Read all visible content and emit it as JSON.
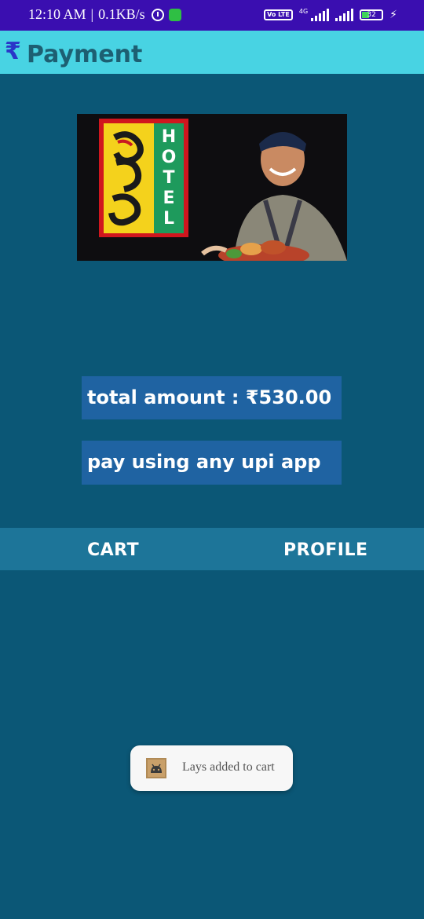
{
  "status_bar": {
    "time": "12:10 AM",
    "speed": "0.1KB/s",
    "network_type": "4G",
    "volte_label": "Vo LTE",
    "battery_level": "32",
    "icons": [
      "alarm-icon",
      "app-notification-icon",
      "volte-icon",
      "signal-icon",
      "battery-icon",
      "charging-icon"
    ]
  },
  "app_bar": {
    "icon": "rupee-icon",
    "title": "Payment"
  },
  "banner": {
    "sign_text": "HOTEL",
    "description": "restaurant-banner-image"
  },
  "payment": {
    "total_label": "total amount : ₹530.00",
    "pay_label": "pay using any upi app"
  },
  "bottom_nav": {
    "items": [
      {
        "label": "CART"
      },
      {
        "label": "PROFILE"
      }
    ]
  },
  "toast": {
    "message": "Lays added to cart",
    "icon": "android-app-icon"
  },
  "colors": {
    "status_bar": "#3a0eb0",
    "app_bar": "#48d3e3",
    "background": "#0b5776",
    "button": "#1f63a2",
    "nav": "#1d7599"
  }
}
